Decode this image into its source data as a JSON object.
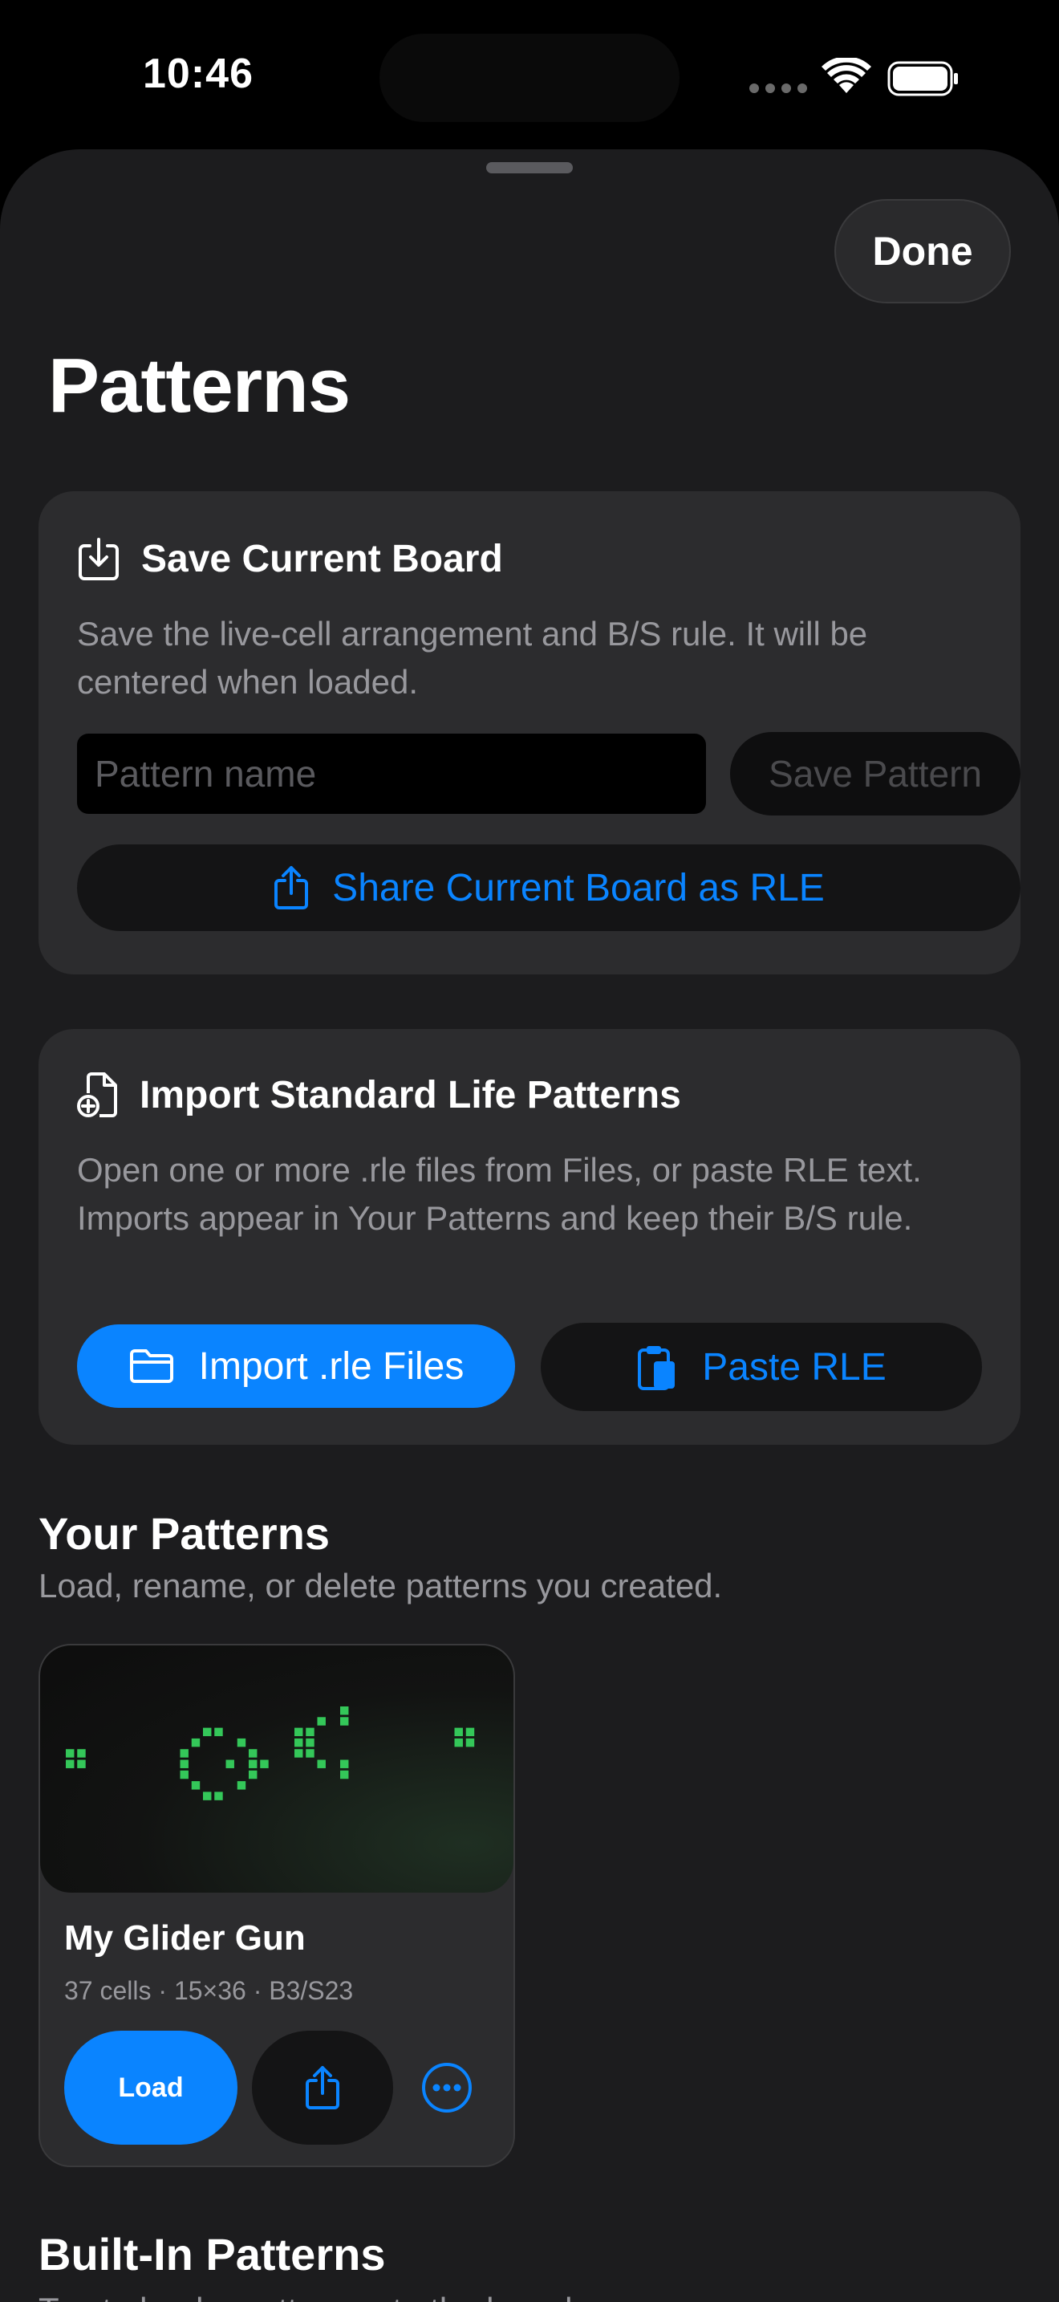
{
  "status_bar": {
    "time": "10:46"
  },
  "sheet": {
    "done_label": "Done",
    "title": "Patterns"
  },
  "save_card": {
    "title": "Save Current Board",
    "description": "Save the live-cell arrangement and B/S rule. It will be centered when loaded.",
    "name_placeholder": "Pattern name",
    "name_value": "",
    "save_label": "Save Pattern",
    "share_label": "Share Current Board as RLE"
  },
  "import_card": {
    "title": "Import Standard Life Patterns",
    "description": "Open one or more .rle files from Files, or paste RLE text. Imports appear in Your Patterns and keep their B/S rule.",
    "import_label": "Import .rle Files",
    "paste_label": "Paste RLE"
  },
  "your_patterns": {
    "title": "Your Patterns",
    "subtitle": "Load, rename, or delete patterns you created.",
    "items": [
      {
        "name": "My Glider Gun",
        "meta": "37 cells · 15×36 · B3/S23",
        "load_label": "Load"
      }
    ]
  },
  "built_in": {
    "title": "Built-In Patterns",
    "subtitle": "Tap to load a pattern onto the board."
  },
  "colors": {
    "accent": "#0a84ff",
    "cell": "#34c759",
    "card": "#2c2c2e",
    "sheet": "#1c1c1e"
  }
}
